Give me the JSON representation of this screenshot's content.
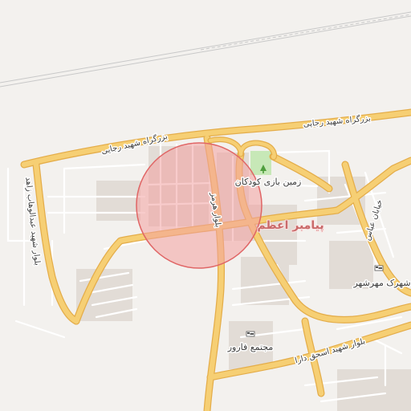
{
  "map": {
    "labels": {
      "highway": "بزرگراه شهید رجایی",
      "road_left": "بلوار شهید عبدالوهاب زاهد",
      "road_center": "بلوار هرمز",
      "road_right": "خیابان عباس",
      "road_bottom": "بلوار شهید اسحق دارا",
      "district": "پیامبر اعظم",
      "playground": "زمین بازی کودکان",
      "poi_1": "شهرک مهرشهر",
      "poi_2": "مجتمع فارور"
    },
    "colors": {
      "background": "#f3f1ee",
      "major_road": "#f6cf74",
      "major_road_casing": "#e7b24d",
      "minor_road": "#ffffff",
      "building": "#dcd5cf",
      "park": "#c7e8b7",
      "highlight_fill": "#f2a0a0",
      "highlight_stroke": "#e06565",
      "railway": "#b8b8b8"
    },
    "highlight_area": "circle",
    "icons": [
      "park-icon",
      "hotel-icon",
      "hotel-icon"
    ]
  }
}
